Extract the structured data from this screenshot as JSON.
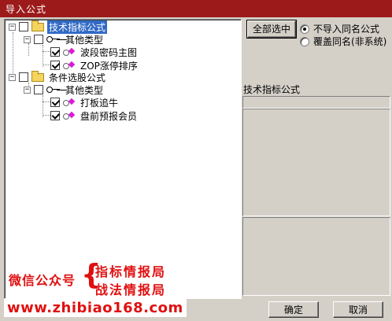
{
  "window": {
    "title": "导入公式"
  },
  "tree": {
    "root1": {
      "label": "技术指标公式",
      "checked": false,
      "expanded": true
    },
    "root1_child": {
      "label": "其他类型",
      "checked": false
    },
    "root1_items": [
      {
        "label": "波段密码主图",
        "checked": true
      },
      {
        "label": "ZOP涨停排序",
        "checked": true
      }
    ],
    "root2": {
      "label": "条件选股公式",
      "checked": false,
      "expanded": true
    },
    "root2_child": {
      "label": "其他类型",
      "checked": false
    },
    "root2_items": [
      {
        "label": "打板追牛",
        "checked": true
      },
      {
        "label": "盘前预报会员",
        "checked": true
      }
    ]
  },
  "right": {
    "select_all_label": "全部选中",
    "radio_no_import": "不导入同名公式",
    "radio_overwrite": "覆盖同名(非系统)",
    "desc_title": "技术指标公式"
  },
  "footer": {
    "ok_label": "确定",
    "cancel_label": "取消"
  },
  "watermark": {
    "line_left": "微信公众号",
    "line_a": "指标情报局",
    "line_b": "战法情报局",
    "url": "www.zhibiao168.com",
    "brace": "{"
  },
  "colors": {
    "title_bar": "#9c1a1a",
    "selection": "#316ac5",
    "watermark": "#e01010"
  }
}
